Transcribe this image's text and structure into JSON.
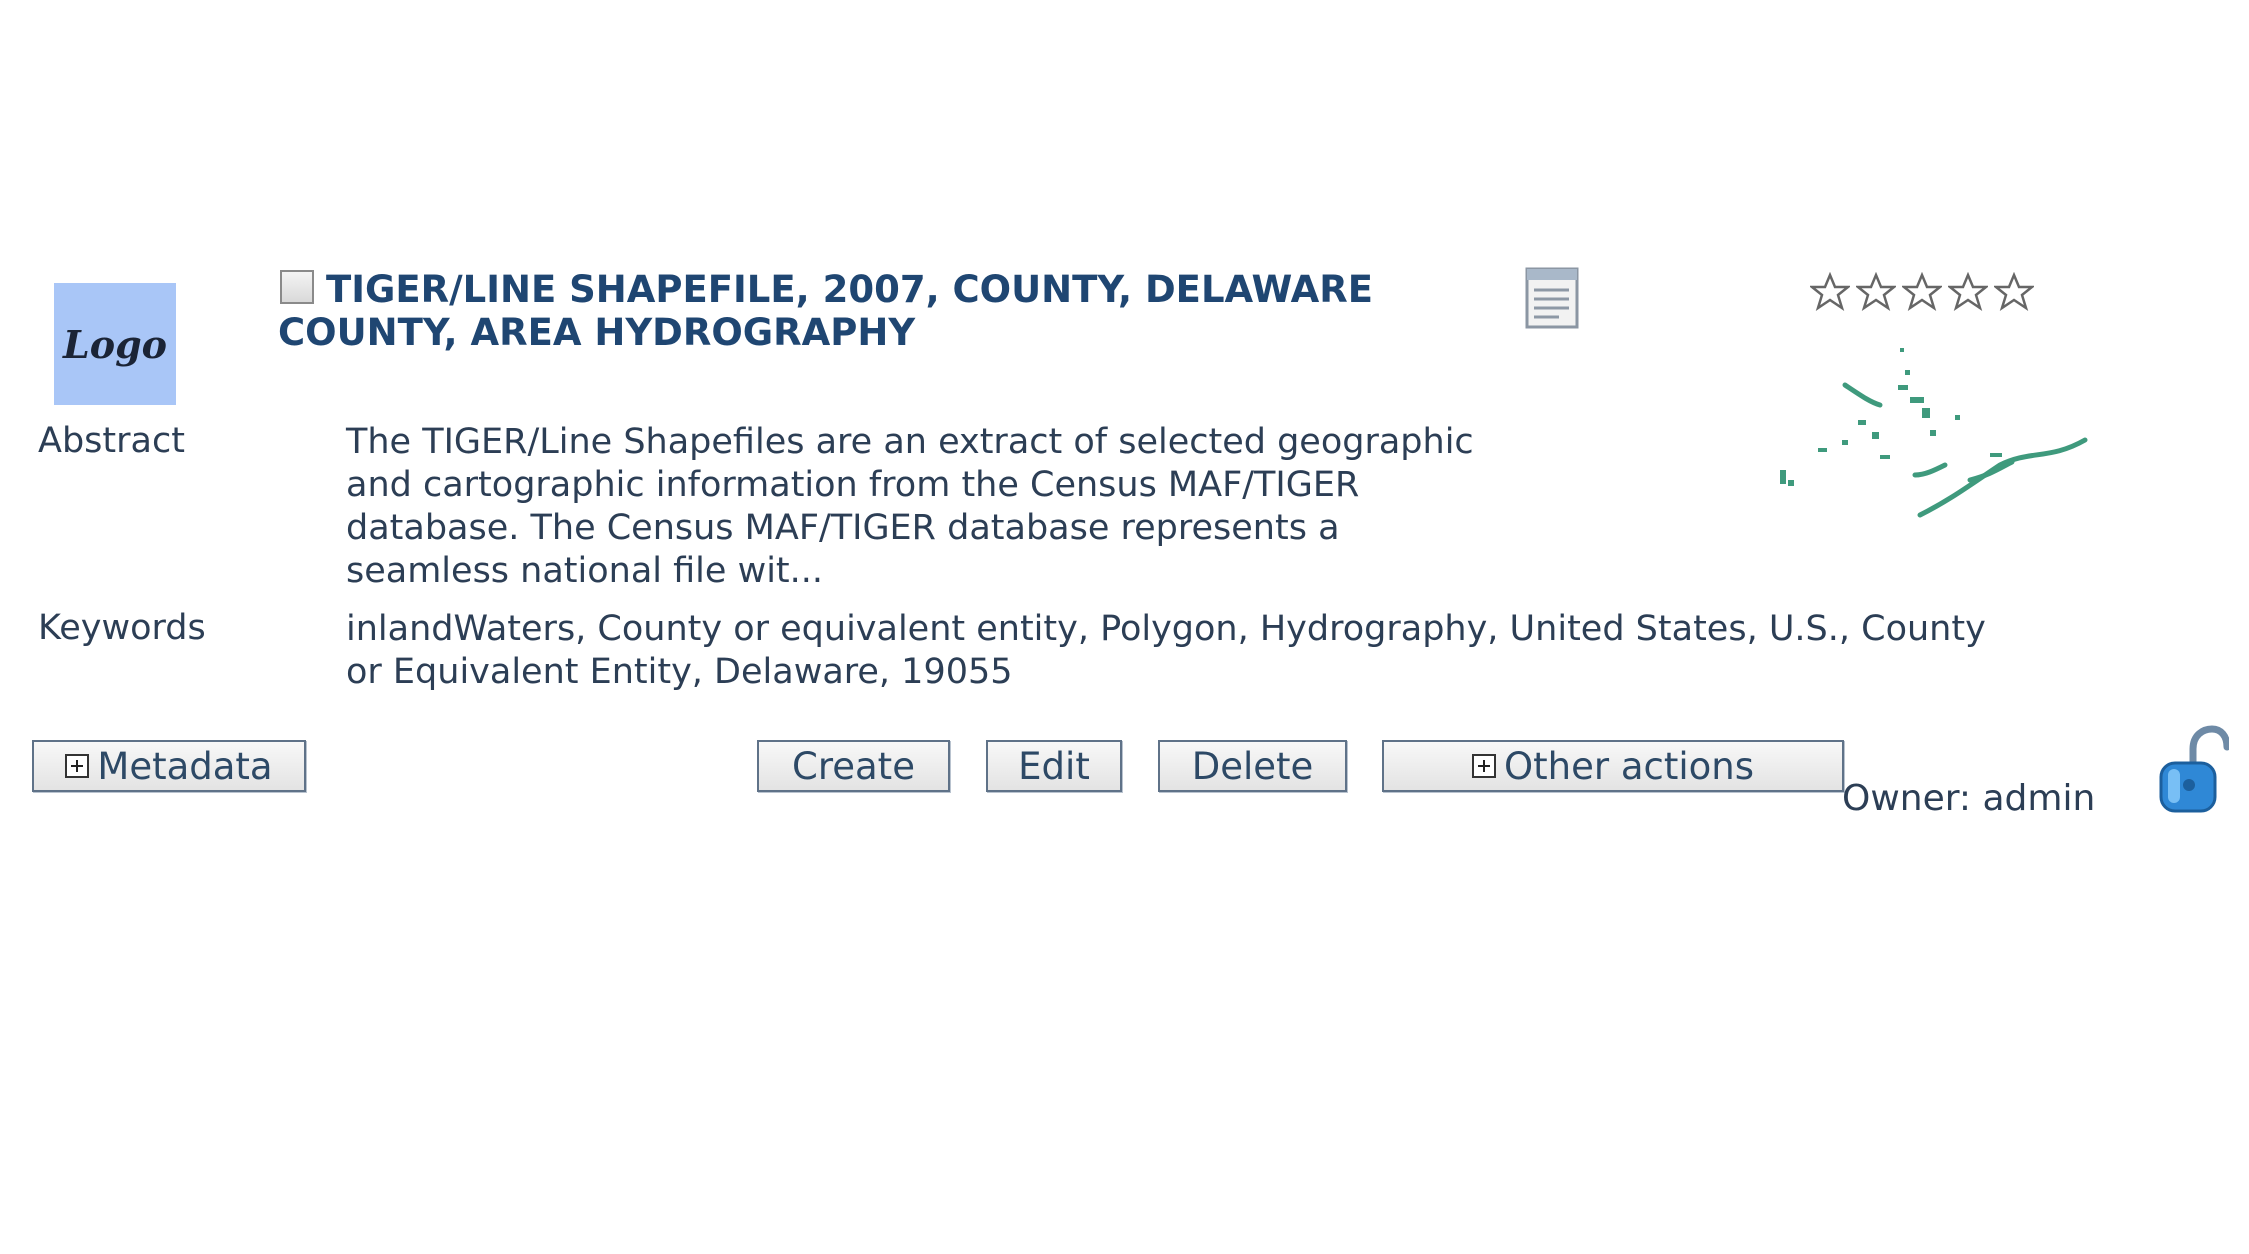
{
  "record": {
    "logo_text": "Logo",
    "title": "TIGER/LINE SHAPEFILE, 2007, COUNTY, DELAWARE COUNTY, AREA HYDROGRAPHY",
    "rating": 0,
    "rating_max": 5,
    "abstract_label": "Abstract",
    "abstract_lines": [
      "The TIGER/Line Shapefiles are an extract of selected geographic",
      "and cartographic information from the Census MAF/TIGER",
      "database. The Census MAF/TIGER database represents a",
      "seamless national file wit..."
    ],
    "keywords_label": "Keywords",
    "keywords_lines": [
      "inlandWaters, County or equivalent entity, Polygon, Hydrography, United States, U.S., County",
      "or Equivalent Entity, Delaware, 19055"
    ],
    "owner": "Owner: admin"
  },
  "actions": {
    "metadata": "Metadata",
    "create": "Create",
    "edit": "Edit",
    "delete": "Delete",
    "other": "Other actions"
  },
  "colors": {
    "title": "#1f4672",
    "text": "#2c3e55",
    "logo_bg": "#a9c6f7",
    "thumbnail_stroke": "#3f9a7d"
  },
  "icons": [
    "checkbox-icon",
    "document-icon",
    "star-icon",
    "thumbnail-map",
    "lock-open-icon",
    "expand-plus-icon"
  ]
}
